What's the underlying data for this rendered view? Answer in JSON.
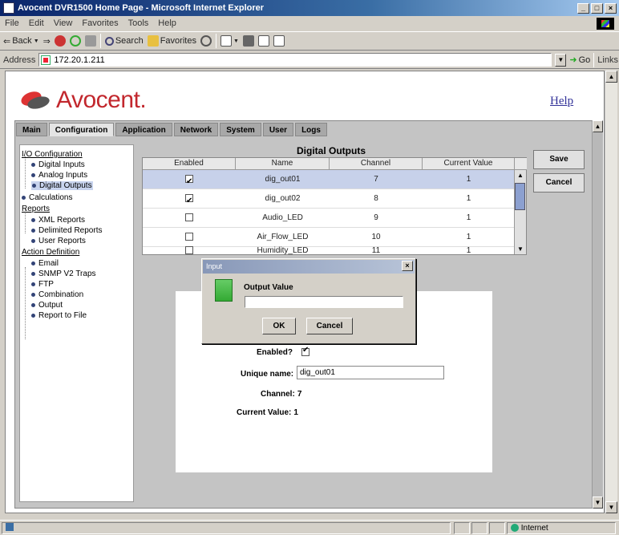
{
  "window": {
    "title": "Avocent DVR1500 Home Page - Microsoft Internet Explorer",
    "controls": [
      "_",
      "□",
      "×"
    ]
  },
  "menu": [
    "File",
    "Edit",
    "View",
    "Favorites",
    "Tools",
    "Help"
  ],
  "toolbar": {
    "back": "Back",
    "search": "Search",
    "favorites": "Favorites"
  },
  "address": {
    "label": "Address",
    "value": "172.20.1.211",
    "go": "Go",
    "links": "Links"
  },
  "page": {
    "brand": "Avocent.",
    "help": "Help",
    "tabs": [
      "Main",
      "Configuration",
      "Application",
      "Network",
      "System",
      "User",
      "Logs"
    ],
    "active_tab": "Configuration"
  },
  "tree": {
    "io_config": "I/O Configuration",
    "digital_inputs": "Digital Inputs",
    "analog_inputs": "Analog Inputs",
    "digital_outputs": "Digital Outputs",
    "calculations": "Calculations",
    "reports": "Reports",
    "xml_reports": "XML Reports",
    "delimited_reports": "Delimited Reports",
    "user_reports": "User Reports",
    "action_definition": "Action Definition",
    "email": "Email",
    "snmp": "SNMP V2 Traps",
    "ftp": "FTP",
    "combination": "Combination",
    "output": "Output",
    "report_to_file": "Report to File"
  },
  "table": {
    "title": "Digital Outputs",
    "columns": [
      "Enabled",
      "Name",
      "Channel",
      "Current Value"
    ],
    "rows": [
      {
        "enabled": true,
        "name": "dig_out01",
        "channel": "7",
        "value": "1",
        "selected": true
      },
      {
        "enabled": true,
        "name": "dig_out02",
        "channel": "8",
        "value": "1",
        "selected": false
      },
      {
        "enabled": false,
        "name": "Audio_LED",
        "channel": "9",
        "value": "1",
        "selected": false
      },
      {
        "enabled": false,
        "name": "Air_Flow_LED",
        "channel": "10",
        "value": "1",
        "selected": false
      },
      {
        "enabled": false,
        "name": "Humidity_LED",
        "channel": "11",
        "value": "1",
        "selected": false
      }
    ]
  },
  "buttons": {
    "save": "Save",
    "cancel": "Cancel"
  },
  "detail": {
    "enabled_label": "Enabled?",
    "enabled": true,
    "unique_label": "Unique name:",
    "unique_value": "dig_out01",
    "channel_label": "Channel:",
    "channel_value": "7",
    "current_label": "Current Value:",
    "current_value": "1"
  },
  "dialog": {
    "title": "Input",
    "prompt": "Output Value",
    "value": "",
    "ok": "OK",
    "cancel": "Cancel"
  },
  "status": {
    "zone": "Internet"
  }
}
